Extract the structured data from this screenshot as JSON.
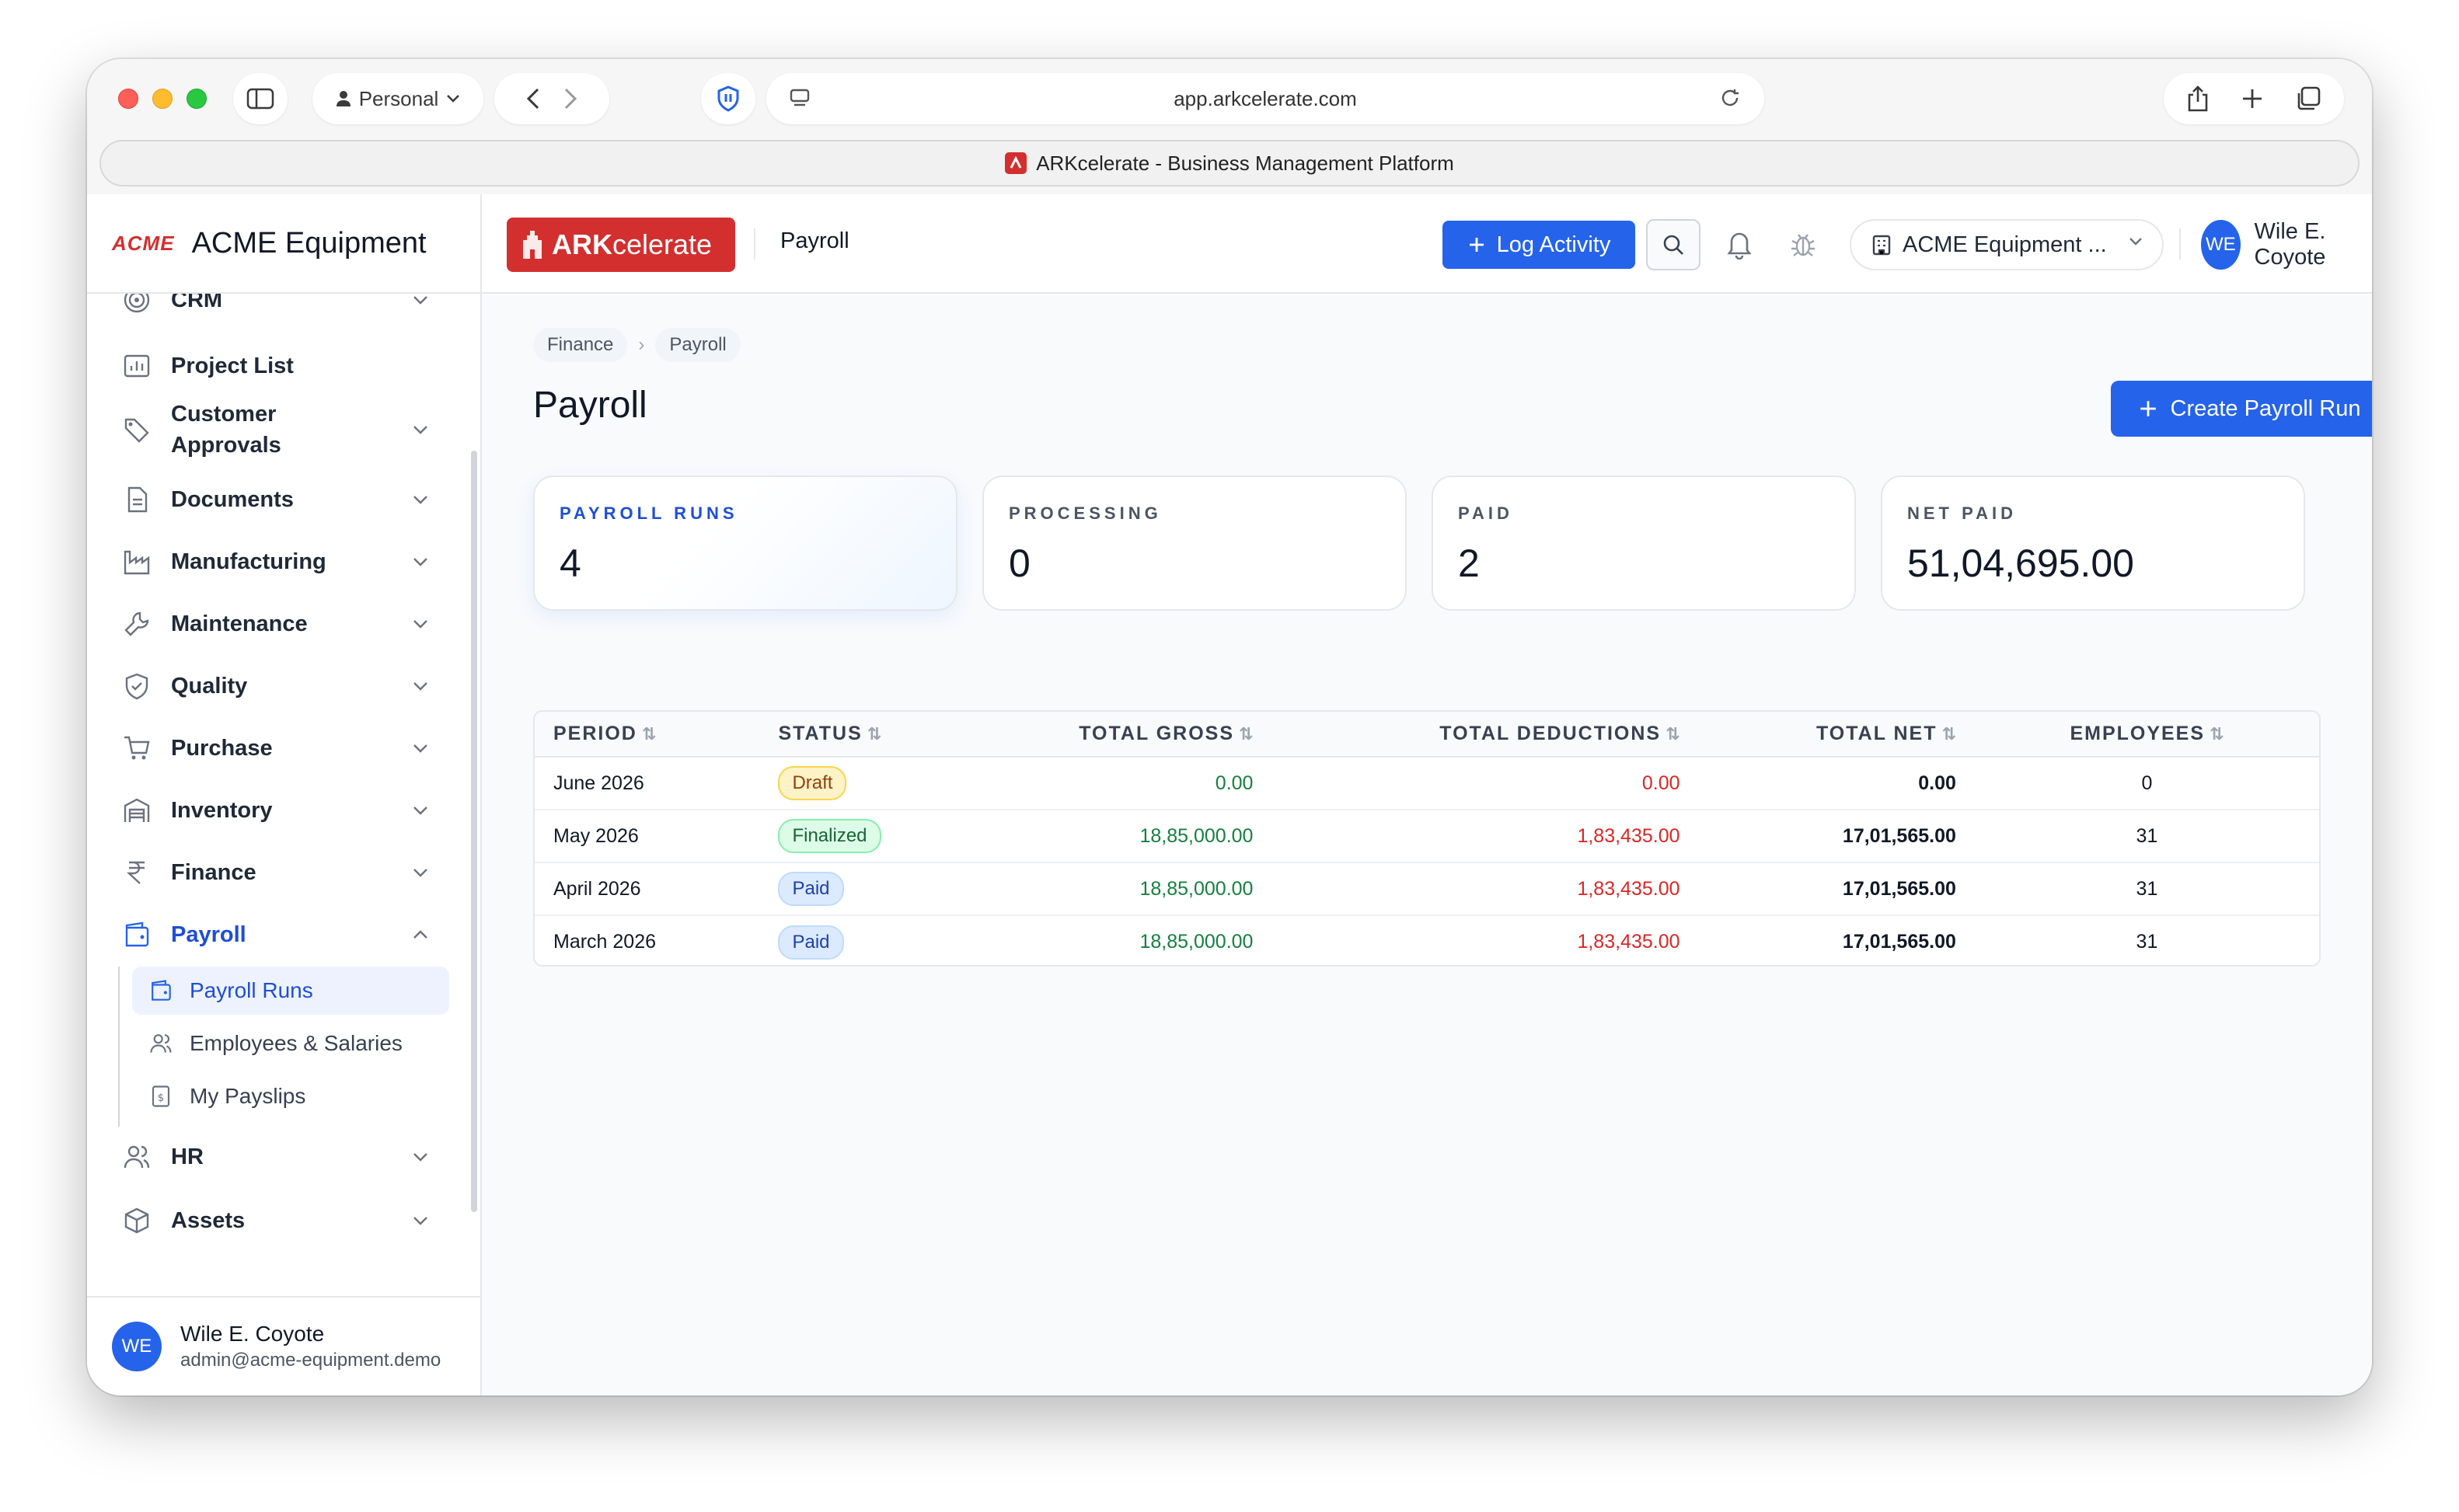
{
  "browser": {
    "profile": "Personal",
    "url": "app.arkcelerate.com",
    "tab_title": "ARKcelerate - Business Management Platform"
  },
  "sidebar": {
    "logo_text": "ACME",
    "company_name": "ACME Equipment",
    "items": [
      {
        "label": "CRM",
        "icon": "target-icon",
        "expandable": true
      },
      {
        "label": "Project List",
        "icon": "chart-icon",
        "expandable": false
      },
      {
        "label": "Customer Approvals",
        "icon": "tag-icon",
        "expandable": true
      },
      {
        "label": "Documents",
        "icon": "document-icon",
        "expandable": true
      },
      {
        "label": "Manufacturing",
        "icon": "factory-icon",
        "expandable": true
      },
      {
        "label": "Maintenance",
        "icon": "wrench-icon",
        "expandable": true
      },
      {
        "label": "Quality",
        "icon": "shield-check-icon",
        "expandable": true
      },
      {
        "label": "Purchase",
        "icon": "cart-icon",
        "expandable": true
      },
      {
        "label": "Inventory",
        "icon": "warehouse-icon",
        "expandable": true
      },
      {
        "label": "Finance",
        "icon": "rupee-icon",
        "expandable": true
      },
      {
        "label": "Payroll",
        "icon": "wallet-icon",
        "expandable": true,
        "expanded": true
      },
      {
        "label": "HR",
        "icon": "users-icon",
        "expandable": true
      },
      {
        "label": "Assets",
        "icon": "box-icon",
        "expandable": true
      }
    ],
    "payroll_sub": [
      {
        "label": "Payroll Runs",
        "icon": "wallet-icon",
        "active": true
      },
      {
        "label": "Employees & Salaries",
        "icon": "users-icon",
        "active": false
      },
      {
        "label": "My Payslips",
        "icon": "payslip-icon",
        "active": false
      }
    ],
    "user": {
      "initials": "WE",
      "name": "Wile E. Coyote",
      "email": "admin@acme-equipment.demo"
    }
  },
  "topbar": {
    "brand_bold": "ARK",
    "brand_rest": "celerate",
    "page": "Payroll",
    "log_activity": "Log Activity",
    "company_selector": "ACME Equipment ...",
    "user_initials": "WE",
    "user_name": "Wile E. Coyote"
  },
  "main": {
    "breadcrumbs": [
      "Finance",
      "Payroll"
    ],
    "title": "Payroll",
    "create_button": "Create Payroll Run",
    "stats": [
      {
        "label": "PAYROLL RUNS",
        "value": "4"
      },
      {
        "label": "PROCESSING",
        "value": "0"
      },
      {
        "label": "PAID",
        "value": "2"
      },
      {
        "label": "NET PAID",
        "value": "51,04,695.00"
      }
    ],
    "table": {
      "columns": [
        "PERIOD",
        "STATUS",
        "TOTAL GROSS",
        "TOTAL DEDUCTIONS",
        "TOTAL NET",
        "EMPLOYEES"
      ],
      "rows": [
        {
          "period": "June 2026",
          "status": "Draft",
          "gross": "0.00",
          "deductions": "0.00",
          "net": "0.00",
          "employees": "0"
        },
        {
          "period": "May 2026",
          "status": "Finalized",
          "gross": "18,85,000.00",
          "deductions": "1,83,435.00",
          "net": "17,01,565.00",
          "employees": "31"
        },
        {
          "period": "April 2026",
          "status": "Paid",
          "gross": "18,85,000.00",
          "deductions": "1,83,435.00",
          "net": "17,01,565.00",
          "employees": "31"
        },
        {
          "period": "March 2026",
          "status": "Paid",
          "gross": "18,85,000.00",
          "deductions": "1,83,435.00",
          "net": "17,01,565.00",
          "employees": "31"
        }
      ]
    }
  },
  "colors": {
    "accent": "#2563eb",
    "brand": "#d32f2f",
    "positive": "#15803d",
    "negative": "#dc2626"
  }
}
